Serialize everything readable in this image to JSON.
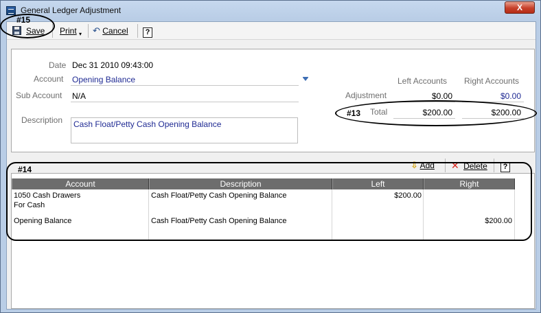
{
  "window": {
    "title": "General Ledger Adjustment",
    "close_label": "X"
  },
  "toolbar": {
    "save_label": "Save",
    "print_label": "Print",
    "cancel_label": "Cancel",
    "help_label": "?"
  },
  "form": {
    "date_label": "Date",
    "date_value": "Dec 31 2010 09:43:00",
    "account_label": "Account",
    "account_value": "Opening Balance",
    "sub_account_label": "Sub Account",
    "sub_account_value": "N/A",
    "description_label": "Description",
    "description_value": "Cash Float/Petty Cash Opening Balance"
  },
  "summary": {
    "left_header": "Left Accounts",
    "right_header": "Right Accounts",
    "adjustment_label": "Adjustment",
    "adjustment_left": "$0.00",
    "adjustment_right": "$0.00",
    "total_label": "Total",
    "total_left": "$200.00",
    "total_right": "$200.00"
  },
  "grid_toolbar": {
    "add_label": "Add",
    "delete_label": "Delete",
    "help_label": "?"
  },
  "grid": {
    "columns": [
      "Account",
      "Description",
      "Left",
      "Right"
    ],
    "rows": [
      {
        "account_line1": "1050 Cash Drawers",
        "account_line2": "For Cash",
        "description": "Cash Float/Petty Cash Opening Balance",
        "left": "$200.00",
        "right": ""
      },
      {
        "account_line1": "Opening Balance",
        "account_line2": "",
        "description": "Cash Float/Petty Cash Opening Balance",
        "left": "",
        "right": "$200.00"
      }
    ]
  },
  "annotations": {
    "a15": "#15",
    "a13": "#13",
    "a14": "#14"
  },
  "colors": {
    "link_blue": "#1f2a93",
    "grid_header": "#6d6d6d",
    "close_red": "#c7402a"
  }
}
